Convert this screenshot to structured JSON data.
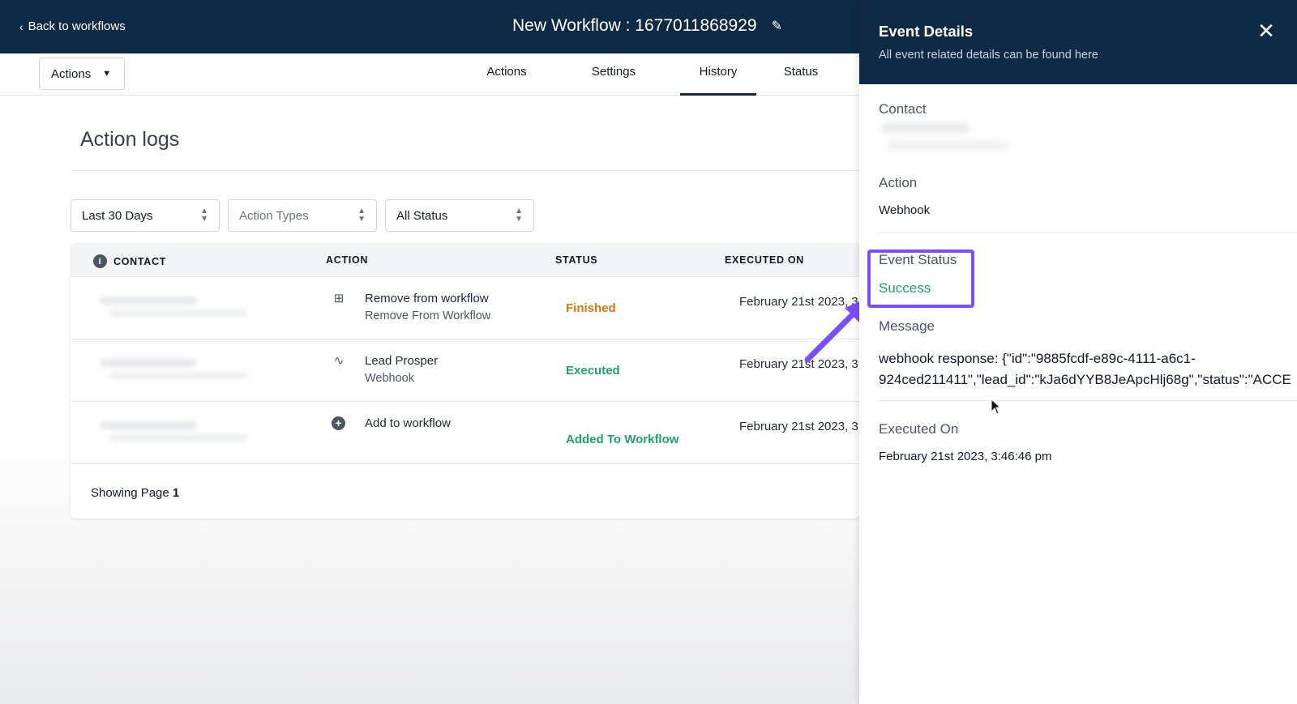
{
  "header": {
    "back_label": "Back to workflows",
    "workflow_title": "New Workflow : 1677011868929"
  },
  "toolbar": {
    "actions_dropdown": "Actions",
    "tabs": [
      "Actions",
      "Settings",
      "History",
      "Status"
    ],
    "active_tab": "History"
  },
  "main": {
    "title": "Action logs",
    "filters": {
      "date": "Last 30 Days",
      "action_types": "Action Types",
      "status": "All Status"
    },
    "columns": [
      "CONTACT",
      "ACTION",
      "STATUS",
      "EXECUTED ON"
    ],
    "rows": [
      {
        "icon": "remove-from-workflow-icon",
        "action": "Remove from workflow",
        "subtitle": "Remove From Workflow",
        "status": "Finished",
        "executed_on": "February 21st 2023, 3"
      },
      {
        "icon": "webhook-icon",
        "action": "Lead Prosper",
        "subtitle": "Webhook",
        "status": "Executed",
        "executed_on": "February 21st 2023, 3"
      },
      {
        "icon": "plus-circle-icon",
        "action": "Add to workflow",
        "subtitle": "",
        "status": "Added To Workflow",
        "executed_on": "February 21st 2023, 3"
      }
    ],
    "pagination_prefix": "Showing Page",
    "pagination_page": "1"
  },
  "panel": {
    "title": "Event Details",
    "subtitle": "All event related details can be found here",
    "contact_label": "Contact",
    "action_label": "Action",
    "action_value": "Webhook",
    "event_status_label": "Event Status",
    "event_status_value": "Success",
    "message_label": "Message",
    "message_line1": "webhook response: {\"id\":\"9885fcdf-e89c-4111-a6c1-",
    "message_line2": "924ced211411\",\"lead_id\":\"kJa6dYYB8JeApcHlj68g\",\"status\":\"ACCE",
    "executed_on_label": "Executed On",
    "executed_on_value": "February 21st 2023, 3:46:46 pm"
  },
  "colors": {
    "header_bg": "#0f2a44",
    "finished": "#d97706",
    "success": "#22a06b",
    "highlight": "#7c4dff"
  }
}
